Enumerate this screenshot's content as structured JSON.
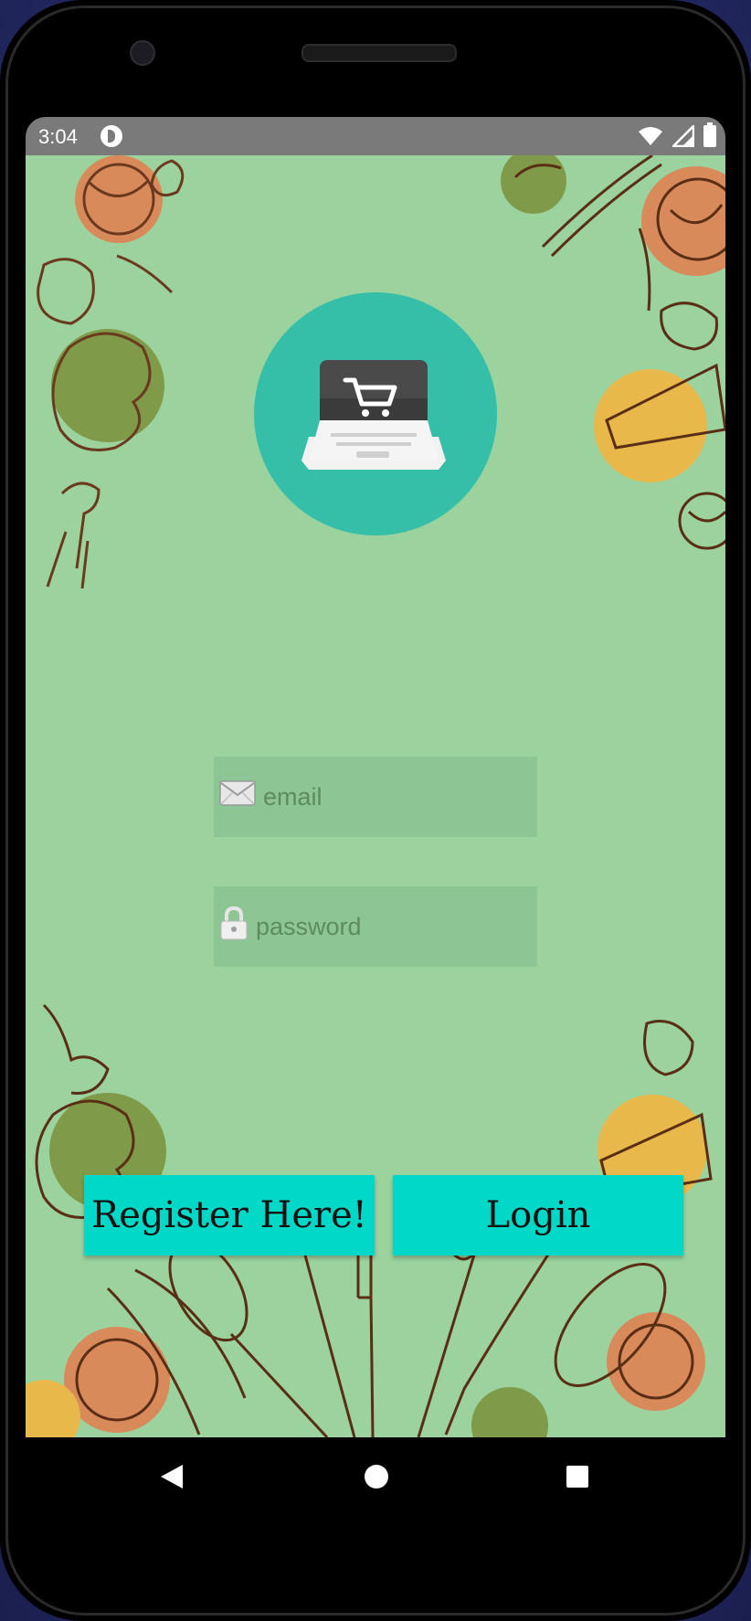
{
  "status_bar": {
    "time": "3:04",
    "icons": [
      "app-notification-icon",
      "wifi-icon",
      "signal-icon",
      "battery-icon"
    ]
  },
  "app": {
    "logo_icon": "shopping-cart-laptop-icon",
    "email": {
      "icon": "envelope-icon",
      "placeholder": "email",
      "value": ""
    },
    "password": {
      "icon": "lock-icon",
      "placeholder": "password",
      "value": ""
    },
    "register_label": "Register Here!",
    "login_label": "Login"
  },
  "nav_bar": {
    "icons": [
      "back-icon",
      "home-icon",
      "recents-icon"
    ]
  },
  "colors": {
    "background": "#9bd29e",
    "logo_circle": "#35bfa9",
    "button": "#02d8c8",
    "field": "#8dc594"
  }
}
